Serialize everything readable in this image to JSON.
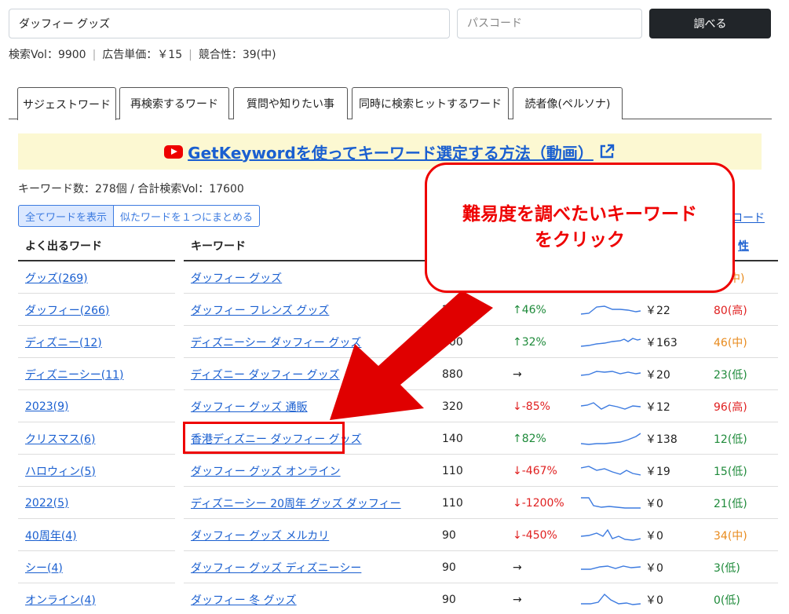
{
  "search": {
    "value": "ダッフィー グッズ",
    "password_placeholder": "パスコード",
    "button_label": "調べる"
  },
  "stats": {
    "vol": "検索Vol：9900",
    "cpc": "広告単価：￥15",
    "competition": "競合性：39(中)",
    "separator": "|"
  },
  "tabs": [
    {
      "label": "サジェストワード",
      "active": true
    },
    {
      "label": "再検索するワード",
      "active": false
    },
    {
      "label": "質問や知りたい事",
      "active": false
    },
    {
      "label": "同時に検索ヒットするワード",
      "active": false
    },
    {
      "label": "読者像(ペルソナ)",
      "active": false
    }
  ],
  "banner": {
    "text": "GetKeywordを使ってキーワード選定する方法（動画）"
  },
  "summary": {
    "text": "キーワード数：278個 / 合計検索Vol：17600"
  },
  "toggles": {
    "show_all": "全てワードを表示",
    "group_similar": "似たワードを１つにまとめる"
  },
  "download": {
    "label": "ロード"
  },
  "table": {
    "col_frequent": "よく出るワード",
    "col_keyword": "キーワード",
    "col_competition": "性",
    "rows": [
      {
        "freq": "グッズ(269)",
        "keyword": "ダッフィー グッズ",
        "vol": "",
        "trend": "",
        "trend_type": "",
        "cpc": "",
        "comp": "中)",
        "comp_level": "mid",
        "spark": ""
      },
      {
        "freq": "ダッフィー(266)",
        "keyword": "ダッフィー フレンズ グッズ",
        "vol": "2900",
        "trend": "↑46%",
        "trend_type": "up",
        "cpc": "￥22",
        "comp": "80(高)",
        "comp_level": "high",
        "spark": "0,18 10,17 20,9 30,8 40,12 50,12 60,13 70,15 76,14"
      },
      {
        "freq": "ディズニー(12)",
        "keyword": "ディズニーシー ダッフィー グッズ",
        "vol": "500",
        "trend": "↑32%",
        "trend_type": "up",
        "cpc": "￥163",
        "comp": "46(中)",
        "comp_level": "mid",
        "spark": "0,18 10,17 20,15 30,14 40,12 50,11 55,9 60,12 66,8 72,10 76,9"
      },
      {
        "freq": "ディズニーシー(11)",
        "keyword": "ディズニー ダッフィー グッズ",
        "vol": "880",
        "trend": "→",
        "trend_type": "flat",
        "cpc": "￥20",
        "comp": "23(低)",
        "comp_level": "low",
        "spark": "0,14 10,13 20,9 30,10 40,9 50,12 60,10 70,12 76,11"
      },
      {
        "freq": "2023(9)",
        "keyword": "ダッフィー グッズ 通販",
        "vol": "320",
        "trend": "↓-85%",
        "trend_type": "down",
        "cpc": "￥12",
        "comp": "96(高)",
        "comp_level": "high",
        "spark": "0,12 8,11 16,8 26,16 36,11 46,13 56,16 66,12 76,13"
      },
      {
        "freq": "クリスマス(6)",
        "keyword": "香港ディズニー ダッフィー グッズ",
        "vol": "140",
        "trend": "↑82%",
        "trend_type": "up",
        "cpc": "￥138",
        "comp": "12(低)",
        "comp_level": "low",
        "spark": "0,19 10,20 20,19 30,19 40,18 50,17 60,14 70,10 76,6"
      },
      {
        "freq": "ハロウィン(5)",
        "keyword": "ダッフィー グッズ オンライン",
        "vol": "110",
        "trend": "↓-467%",
        "trend_type": "down",
        "cpc": "￥19",
        "comp": "15(低)",
        "comp_level": "low",
        "spark": "0,9 10,7 20,12 30,10 40,14 50,17 58,12 66,16 76,18"
      },
      {
        "freq": "2022(5)",
        "keyword": "ディズニーシー 20周年 グッズ ダッフィー",
        "vol": "110",
        "trend": "↓-1200%",
        "trend_type": "down",
        "cpc": "￥0",
        "comp": "21(低)",
        "comp_level": "low",
        "spark": "0,6 10,6 16,16 26,18 36,17 46,18 56,19 66,19 76,19"
      },
      {
        "freq": "40周年(4)",
        "keyword": "ダッフィー グッズ メルカリ",
        "vol": "90",
        "trend": "↓-450%",
        "trend_type": "down",
        "cpc": "￥0",
        "comp": "34(中)",
        "comp_level": "mid",
        "spark": "0,14 10,13 20,10 28,14 34,6 40,17 48,14 56,18 66,19 76,17"
      },
      {
        "freq": "シー(4)",
        "keyword": "ダッフィー グッズ ディズニーシー",
        "vol": "90",
        "trend": "→",
        "trend_type": "flat",
        "cpc": "￥0",
        "comp": "3(低)",
        "comp_level": "low",
        "spark": "0,15 12,15 24,12 34,11 44,14 54,11 64,13 76,12"
      },
      {
        "freq": "オンライン(4)",
        "keyword": "ダッフィー 冬 グッズ",
        "vol": "90",
        "trend": "→",
        "trend_type": "flat",
        "cpc": "￥0",
        "comp": "0(低)",
        "comp_level": "low",
        "spark": "0,18 12,18 22,16 30,6 38,13 48,18 58,17 66,19 76,18"
      }
    ]
  },
  "callout": {
    "line1": "難易度を調べたいキーワード",
    "line2": "をクリック"
  },
  "colors": {
    "accent": "#e00000",
    "link": "#1a5fd0",
    "button": "#212529",
    "banner_bg": "#fcf8d2",
    "low": "#1e8a3a",
    "mid": "#e88a1c",
    "high": "#e02020"
  }
}
